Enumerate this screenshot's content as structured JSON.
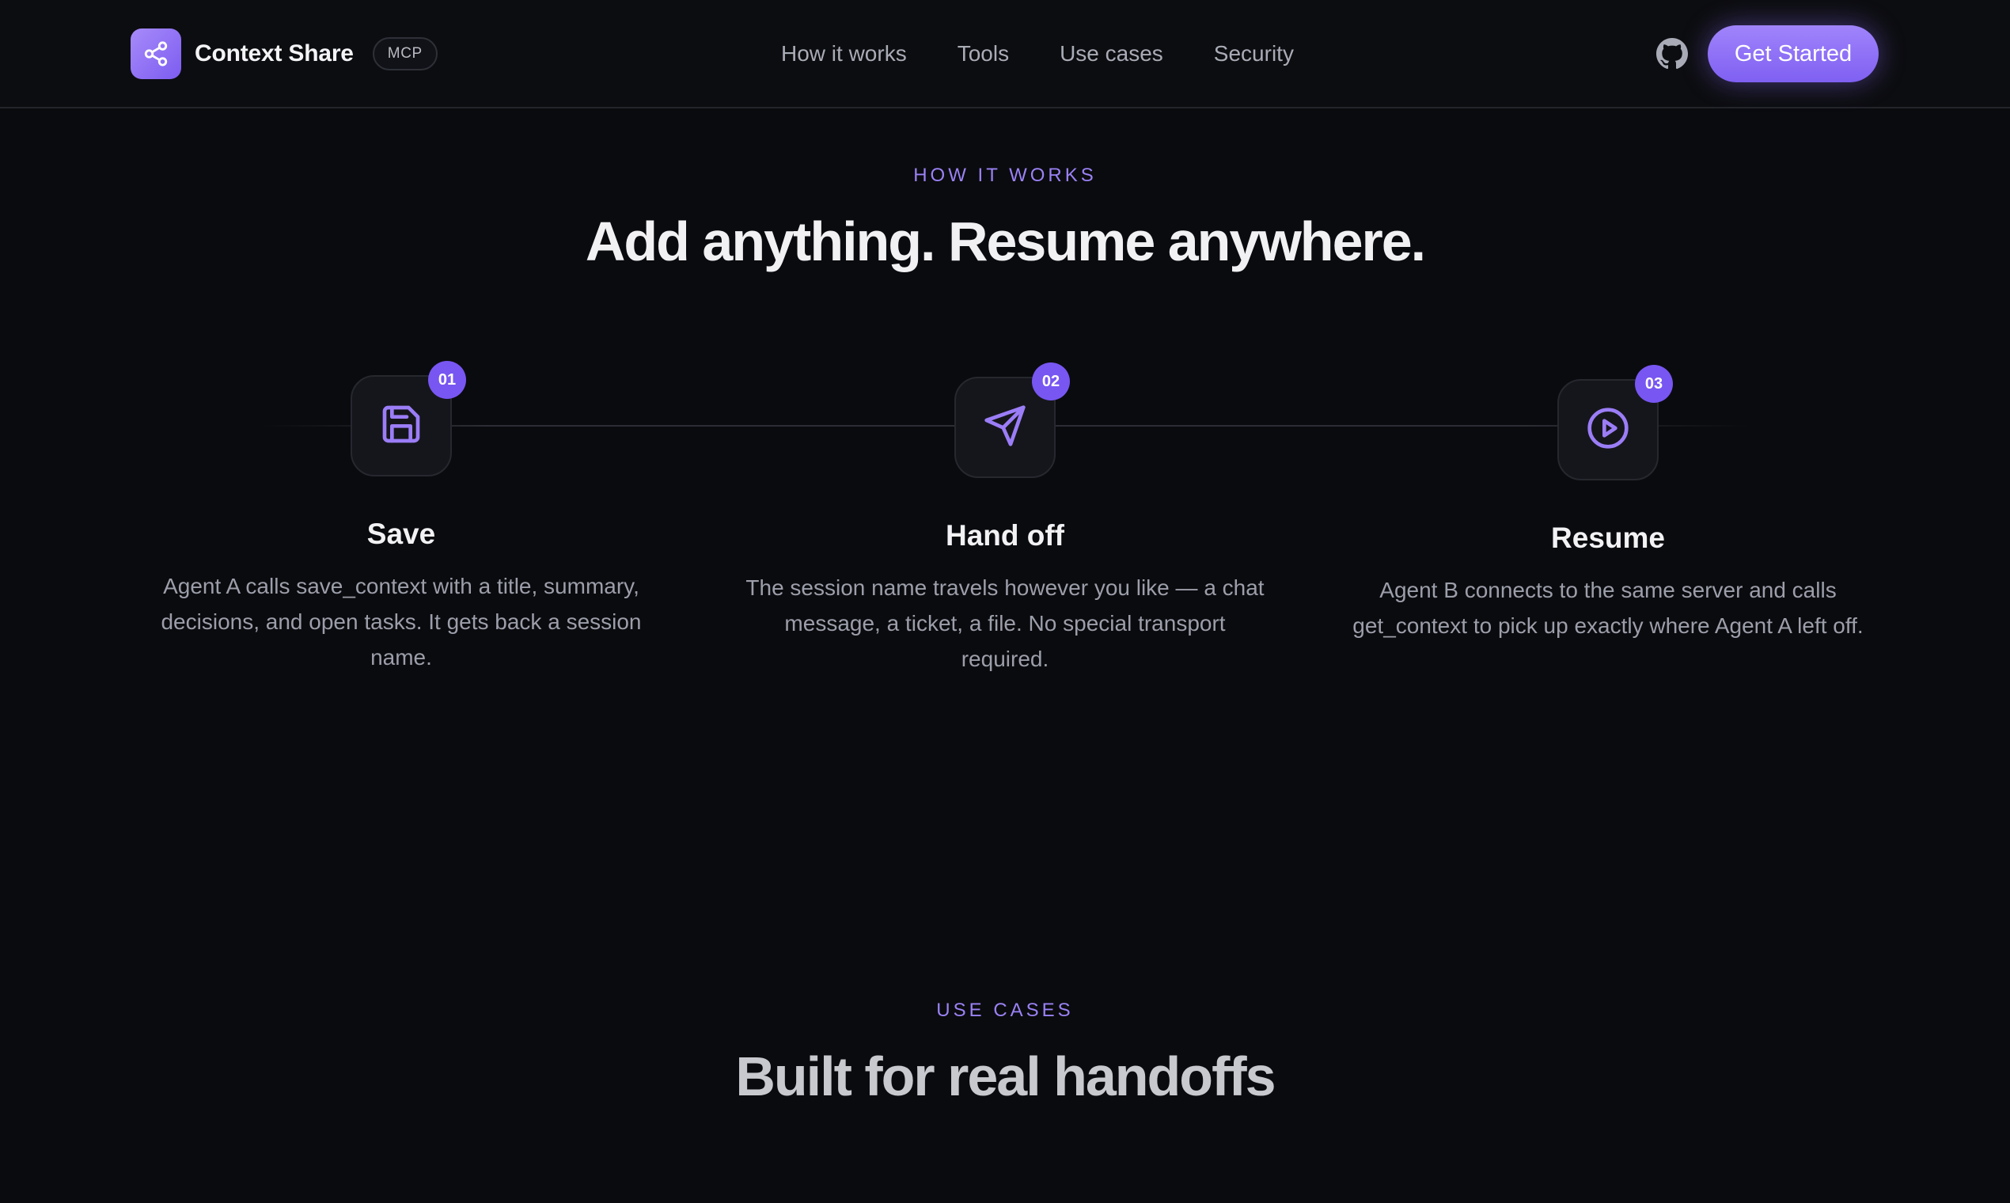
{
  "header": {
    "brand_name": "Context Share",
    "badge": "MCP",
    "nav": [
      "How it works",
      "Tools",
      "Use cases",
      "Security"
    ],
    "cta_label": "Get Started"
  },
  "how_it_works": {
    "eyebrow": "HOW IT WORKS",
    "title": "Add anything. Resume anywhere.",
    "steps": [
      {
        "number": "01",
        "icon": "save-icon",
        "title": "Save",
        "description": "Agent A calls save_context with a title, summary, decisions, and open tasks. It gets back a session name."
      },
      {
        "number": "02",
        "icon": "send-icon",
        "title": "Hand off",
        "description": "The session name travels however you like — a chat message, a ticket, a file. No special transport required."
      },
      {
        "number": "03",
        "icon": "play-circle-icon",
        "title": "Resume",
        "description": "Agent B connects to the same server and calls get_context to pick up exactly where Agent A left off."
      }
    ]
  },
  "use_cases": {
    "eyebrow": "USE CASES",
    "title": "Built for real handoffs"
  },
  "colors": {
    "background": "#0a0b0e",
    "accent": "#8b6cfa",
    "accent_text": "#9b82f6",
    "badge_fill": "#7856f2"
  }
}
